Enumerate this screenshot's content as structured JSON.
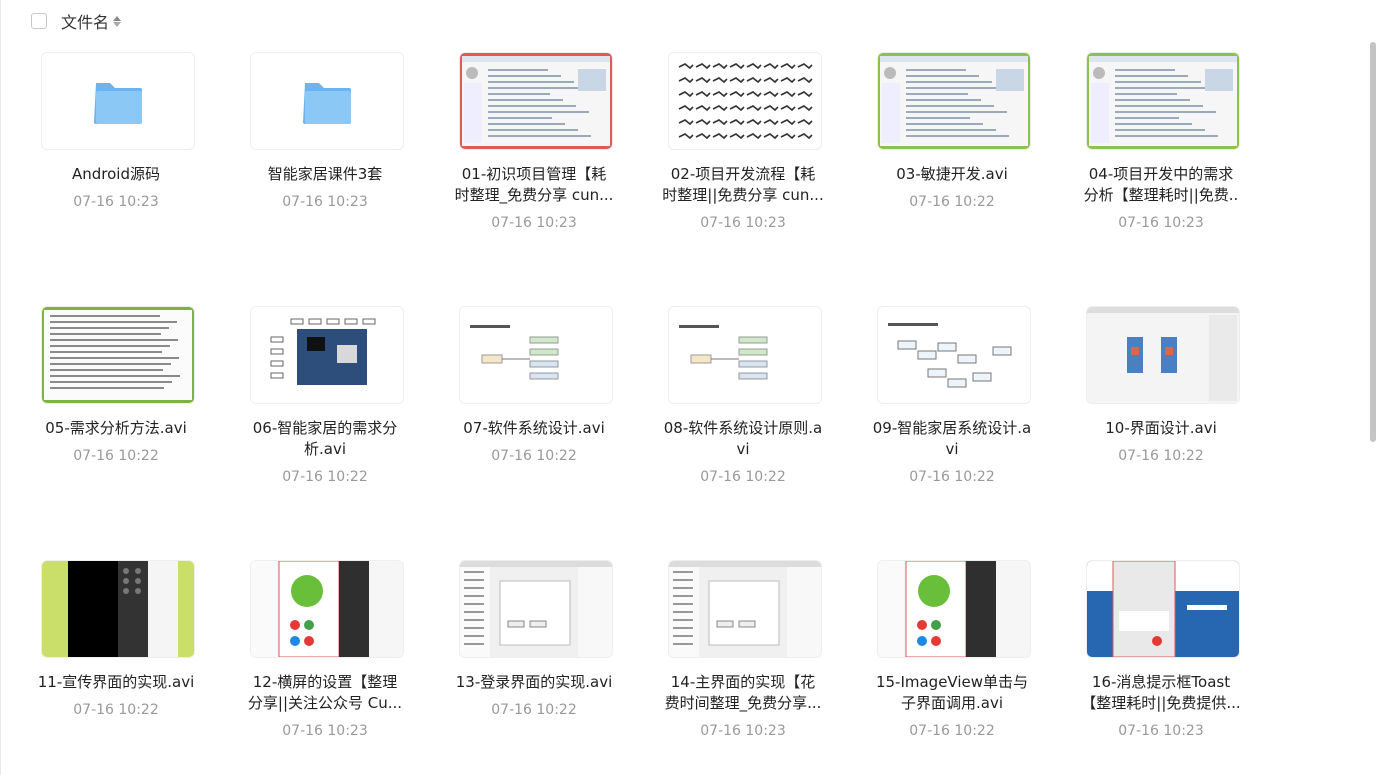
{
  "header": {
    "sort_label": "文件名"
  },
  "files": [
    {
      "name": [
        "Android源码"
      ],
      "time": "07-16 10:23",
      "thumb": "folder"
    },
    {
      "name": [
        "智能家居课件3套"
      ],
      "time": "07-16 10:23",
      "thumb": "folder"
    },
    {
      "name": [
        "01-初识项目管理【耗",
        "时整理_免费分享 cun..."
      ],
      "time": "07-16 10:23",
      "thumb": "web-red"
    },
    {
      "name": [
        "02-项目开发流程【耗",
        "时整理||免费分享 cun..."
      ],
      "time": "07-16 10:23",
      "thumb": "birds"
    },
    {
      "name": [
        "03-敏捷开发.avi"
      ],
      "time": "07-16 10:22",
      "thumb": "web-green"
    },
    {
      "name": [
        "04-项目开发中的需求",
        "分析【整理耗时||免费.."
      ],
      "time": "07-16 10:23",
      "thumb": "web-green"
    },
    {
      "name": [
        "05-需求分析方法.avi"
      ],
      "time": "07-16 10:22",
      "thumb": "doc-green"
    },
    {
      "name": [
        "06-智能家居的需求分",
        "析.avi"
      ],
      "time": "07-16 10:22",
      "thumb": "board"
    },
    {
      "name": [
        "07-软件系统设计.avi"
      ],
      "time": "07-16 10:22",
      "thumb": "slide"
    },
    {
      "name": [
        "08-软件系统设计原则.a",
        "vi"
      ],
      "time": "07-16 10:22",
      "thumb": "slide"
    },
    {
      "name": [
        "09-智能家居系统设计.a",
        "vi"
      ],
      "time": "07-16 10:22",
      "thumb": "flow"
    },
    {
      "name": [
        "10-界面设计.avi"
      ],
      "time": "07-16 10:22",
      "thumb": "ide-phones"
    },
    {
      "name": [
        "11-宣传界面的实现.avi"
      ],
      "time": "07-16 10:22",
      "thumb": "emulator-green"
    },
    {
      "name": [
        "12-横屏的设置【整理",
        "分享||关注公众号 Cu..."
      ],
      "time": "07-16 10:23",
      "thumb": "ide-robot"
    },
    {
      "name": [
        "13-登录界面的实现.avi"
      ],
      "time": "07-16 10:22",
      "thumb": "ide-dialog"
    },
    {
      "name": [
        "14-主界面的实现【花",
        "费时间整理_免费分享..."
      ],
      "time": "07-16 10:23",
      "thumb": "ide-dialog2"
    },
    {
      "name": [
        "15-ImageView单击与",
        "子界面调用.avi"
      ],
      "time": "07-16 10:22",
      "thumb": "ide-robot2"
    },
    {
      "name": [
        "16-消息提示框Toast",
        "【整理耗时||免费提供..."
      ],
      "time": "07-16 10:23",
      "thumb": "emulator-blue"
    }
  ],
  "colors": {
    "folder": "#6cb4f0",
    "accent_red": "#e05858",
    "accent_green": "#8bc34a",
    "time": "#999999"
  }
}
